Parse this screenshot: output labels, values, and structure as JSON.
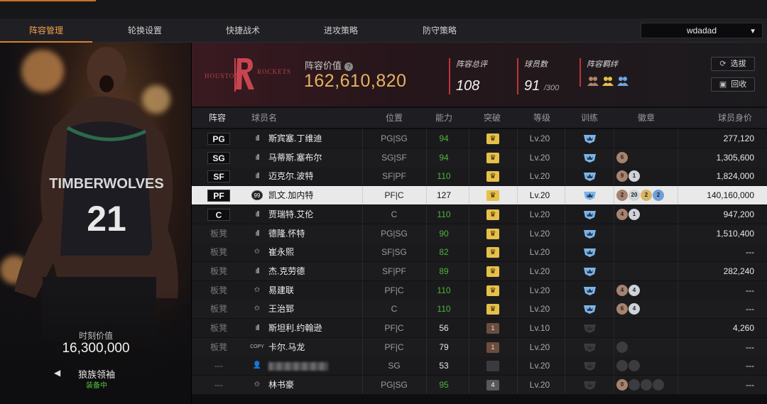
{
  "nav": {
    "tabs": [
      "阵容管理",
      "轮换设置",
      "快捷战术",
      "进攻策略",
      "防守策略"
    ],
    "active_tab": "阵容管理",
    "account_selector": "wdadad"
  },
  "player_card": {
    "value_label": "时刻价值",
    "value": "16,300,000",
    "skill_name": "狼族领袖",
    "skill_status": "装备中"
  },
  "team_header": {
    "team_logo_text": "HOUSTON ROCKETS",
    "lineup_value_label": "阵容价值",
    "help_icon": "question-icon",
    "lineup_value": "162,610,820",
    "overall_label": "阵容总评",
    "overall_value": "108",
    "player_count_label": "球员数",
    "player_count_value": "91",
    "player_count_max": "/300",
    "bond_label": "阵容羁绊",
    "select_button": "选拔",
    "recycle_button": "回收"
  },
  "table": {
    "headers": [
      "阵容",
      "球员名",
      "位置",
      "能力",
      "突破",
      "等级",
      "训练",
      "徽章",
      "球员身价"
    ],
    "rows": [
      {
        "slot": "PG",
        "starter": true,
        "type": "bars",
        "name": "斯宾塞.丁维迪",
        "position": "PG|SG",
        "ability": "94",
        "ability_color": "green",
        "breakthrough": "gold",
        "breakthrough_text": "",
        "level": "Lv.20",
        "train": "blue",
        "badges": [],
        "value": "277,120"
      },
      {
        "slot": "SG",
        "starter": true,
        "type": "bars",
        "name": "马蒂斯.塞布尔",
        "position": "SG|SF",
        "ability": "94",
        "ability_color": "green",
        "breakthrough": "gold",
        "breakthrough_text": "",
        "level": "Lv.20",
        "train": "blue",
        "badges": [
          {
            "c": "bronze",
            "t": "6"
          }
        ],
        "value": "1,305,600"
      },
      {
        "slot": "SF",
        "starter": true,
        "type": "bars",
        "name": "迈克尔.波特",
        "position": "SF|PF",
        "ability": "110",
        "ability_color": "green",
        "breakthrough": "gold",
        "breakthrough_text": "",
        "level": "Lv.20",
        "train": "blue",
        "badges": [
          {
            "c": "bronze",
            "t": "9"
          },
          {
            "c": "silver",
            "t": "1"
          }
        ],
        "value": "1,824,000"
      },
      {
        "slot": "PF",
        "starter": true,
        "selected": true,
        "type": "circle",
        "type_text": "99",
        "name": "凯文.加内特",
        "position": "PF|C",
        "ability": "127",
        "ability_color": "dark",
        "breakthrough": "gold",
        "breakthrough_text": "",
        "level": "Lv.20",
        "train": "blue",
        "badges": [
          {
            "c": "bronze",
            "t": "2"
          },
          {
            "c": "silver",
            "t": "20"
          },
          {
            "c": "gold",
            "t": "2"
          },
          {
            "c": "blue",
            "t": "2"
          }
        ],
        "value": "140,160,000"
      },
      {
        "slot": "C",
        "starter": true,
        "type": "bars",
        "name": "贾瑞特.艾伦",
        "position": "C",
        "ability": "110",
        "ability_color": "green",
        "breakthrough": "gold",
        "breakthrough_text": "",
        "level": "Lv.20",
        "train": "blue",
        "badges": [
          {
            "c": "bronze",
            "t": "4"
          },
          {
            "c": "silver",
            "t": "1"
          }
        ],
        "value": "947,200"
      },
      {
        "slot": "板凳",
        "starter": false,
        "type": "bars",
        "name": "德隆.怀特",
        "position": "PG|SG",
        "ability": "90",
        "ability_color": "green",
        "breakthrough": "gold",
        "breakthrough_text": "",
        "level": "Lv.20",
        "train": "blue",
        "badges": [],
        "value": "1,510,400"
      },
      {
        "slot": "板凳",
        "starter": false,
        "type": "star",
        "name": "崔永熙",
        "position": "SF|SG",
        "ability": "82",
        "ability_color": "green",
        "breakthrough": "gold",
        "breakthrough_text": "",
        "level": "Lv.20",
        "train": "blue",
        "badges": [],
        "value": "---"
      },
      {
        "slot": "板凳",
        "starter": false,
        "type": "bars",
        "name": "杰.克劳德",
        "position": "SF|PF",
        "ability": "89",
        "ability_color": "green",
        "breakthrough": "gold",
        "breakthrough_text": "",
        "level": "Lv.20",
        "train": "blue",
        "badges": [],
        "value": "282,240"
      },
      {
        "slot": "板凳",
        "starter": false,
        "type": "star",
        "name": "易建联",
        "position": "PF|C",
        "ability": "110",
        "ability_color": "green",
        "breakthrough": "gold",
        "breakthrough_text": "",
        "level": "Lv.20",
        "train": "blue",
        "badges": [
          {
            "c": "bronze",
            "t": "4"
          },
          {
            "c": "silver",
            "t": "4"
          }
        ],
        "value": "---"
      },
      {
        "slot": "板凳",
        "starter": false,
        "type": "star",
        "name": "王治郅",
        "position": "C",
        "ability": "110",
        "ability_color": "green",
        "breakthrough": "gold",
        "breakthrough_text": "",
        "level": "Lv.20",
        "train": "blue",
        "badges": [
          {
            "c": "bronze",
            "t": "6"
          },
          {
            "c": "silver",
            "t": "4"
          }
        ],
        "value": "---"
      },
      {
        "slot": "板凳",
        "starter": false,
        "type": "bars",
        "name": "斯坦利.约翰逊",
        "position": "PF|C",
        "ability": "56",
        "ability_color": "white",
        "breakthrough": "brown",
        "breakthrough_text": "1",
        "level": "Lv.10",
        "train": "dark",
        "badges": [],
        "value": "4,260"
      },
      {
        "slot": "板凳",
        "starter": false,
        "type": "copy",
        "type_text": "COPY",
        "name": "卡尔.马龙",
        "position": "PF|C",
        "ability": "79",
        "ability_color": "white",
        "breakthrough": "brown",
        "breakthrough_text": "1",
        "level": "Lv.20",
        "train": "dark",
        "badges": [
          {
            "c": "dark",
            "t": "0"
          }
        ],
        "value": "---"
      },
      {
        "slot": "---",
        "starter": false,
        "type": "person",
        "name": "",
        "blurred": true,
        "position": "SG",
        "ability": "53",
        "ability_color": "white",
        "breakthrough": "dim",
        "breakthrough_text": "",
        "level": "Lv.20",
        "train": "dark",
        "badges": [
          {
            "c": "dark",
            "t": "0"
          },
          {
            "c": "dark",
            "t": "0"
          }
        ],
        "value": "---"
      },
      {
        "slot": "---",
        "starter": false,
        "type": "star",
        "name": "林书豪",
        "position": "PG|SG",
        "ability": "95",
        "ability_color": "green",
        "breakthrough": "gray",
        "breakthrough_text": "4",
        "level": "Lv.20",
        "train": "dark",
        "badges": [
          {
            "c": "bronze",
            "t": "0"
          },
          {
            "c": "dark",
            "t": "0"
          },
          {
            "c": "dark",
            "t": "0"
          },
          {
            "c": "dark",
            "t": "0"
          }
        ],
        "value": "---"
      }
    ]
  },
  "colors": {
    "accent": "#d4842f",
    "lineup_value": "#e6b25f",
    "green_ability": "#4fb43a",
    "stat_marker": "#c0323a"
  }
}
